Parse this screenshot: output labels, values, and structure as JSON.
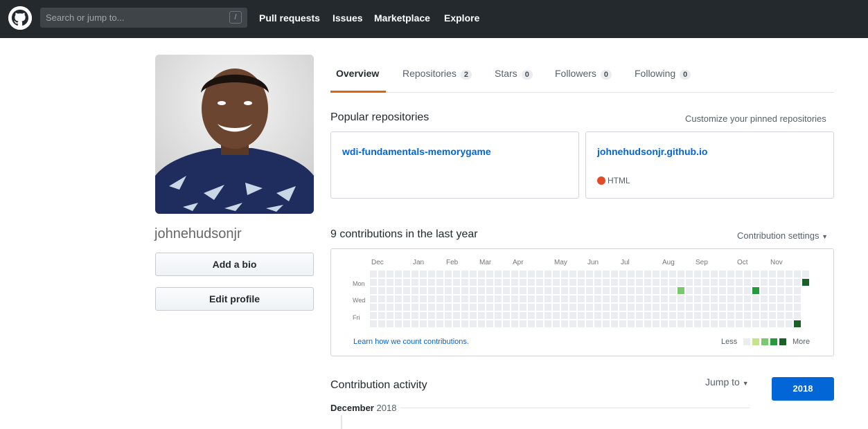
{
  "header": {
    "search_placeholder": "Search or jump to...",
    "search_shortcut": "/",
    "nav": [
      "Pull requests",
      "Issues",
      "Marketplace",
      "Explore"
    ]
  },
  "profile": {
    "username": "johnehudsonjr",
    "add_bio_label": "Add a bio",
    "edit_profile_label": "Edit profile"
  },
  "tabs": [
    {
      "label": "Overview",
      "count": ""
    },
    {
      "label": "Repositories",
      "count": "2"
    },
    {
      "label": "Stars",
      "count": "0"
    },
    {
      "label": "Followers",
      "count": "0"
    },
    {
      "label": "Following",
      "count": "0"
    }
  ],
  "popular": {
    "title": "Popular repositories",
    "customize_link": "Customize your pinned repositories",
    "repos": [
      {
        "name": "wdi-fundamentals-memorygame",
        "language": ""
      },
      {
        "name": "johnehudsonjr.github.io",
        "language": "HTML",
        "language_color": "#e34c26"
      }
    ]
  },
  "contributions": {
    "title": "9 contributions in the last year",
    "settings_label": "Contribution settings",
    "months": [
      "Dec",
      "Jan",
      "Feb",
      "Mar",
      "Apr",
      "May",
      "Jun",
      "Jul",
      "Aug",
      "Sep",
      "Oct",
      "Nov"
    ],
    "weekdays": [
      "Mon",
      "Wed",
      "Fri"
    ],
    "learn_link": "Learn how we count contributions.",
    "legend_less": "Less",
    "legend_more": "More",
    "colors": [
      "#ebedf0",
      "#c6e48b",
      "#7bc96f",
      "#239a3b",
      "#196127"
    ]
  },
  "activity": {
    "title": "Contribution activity",
    "jump_label": "Jump to",
    "year_button": "2018",
    "month_label": "December",
    "month_year": "2018"
  }
}
